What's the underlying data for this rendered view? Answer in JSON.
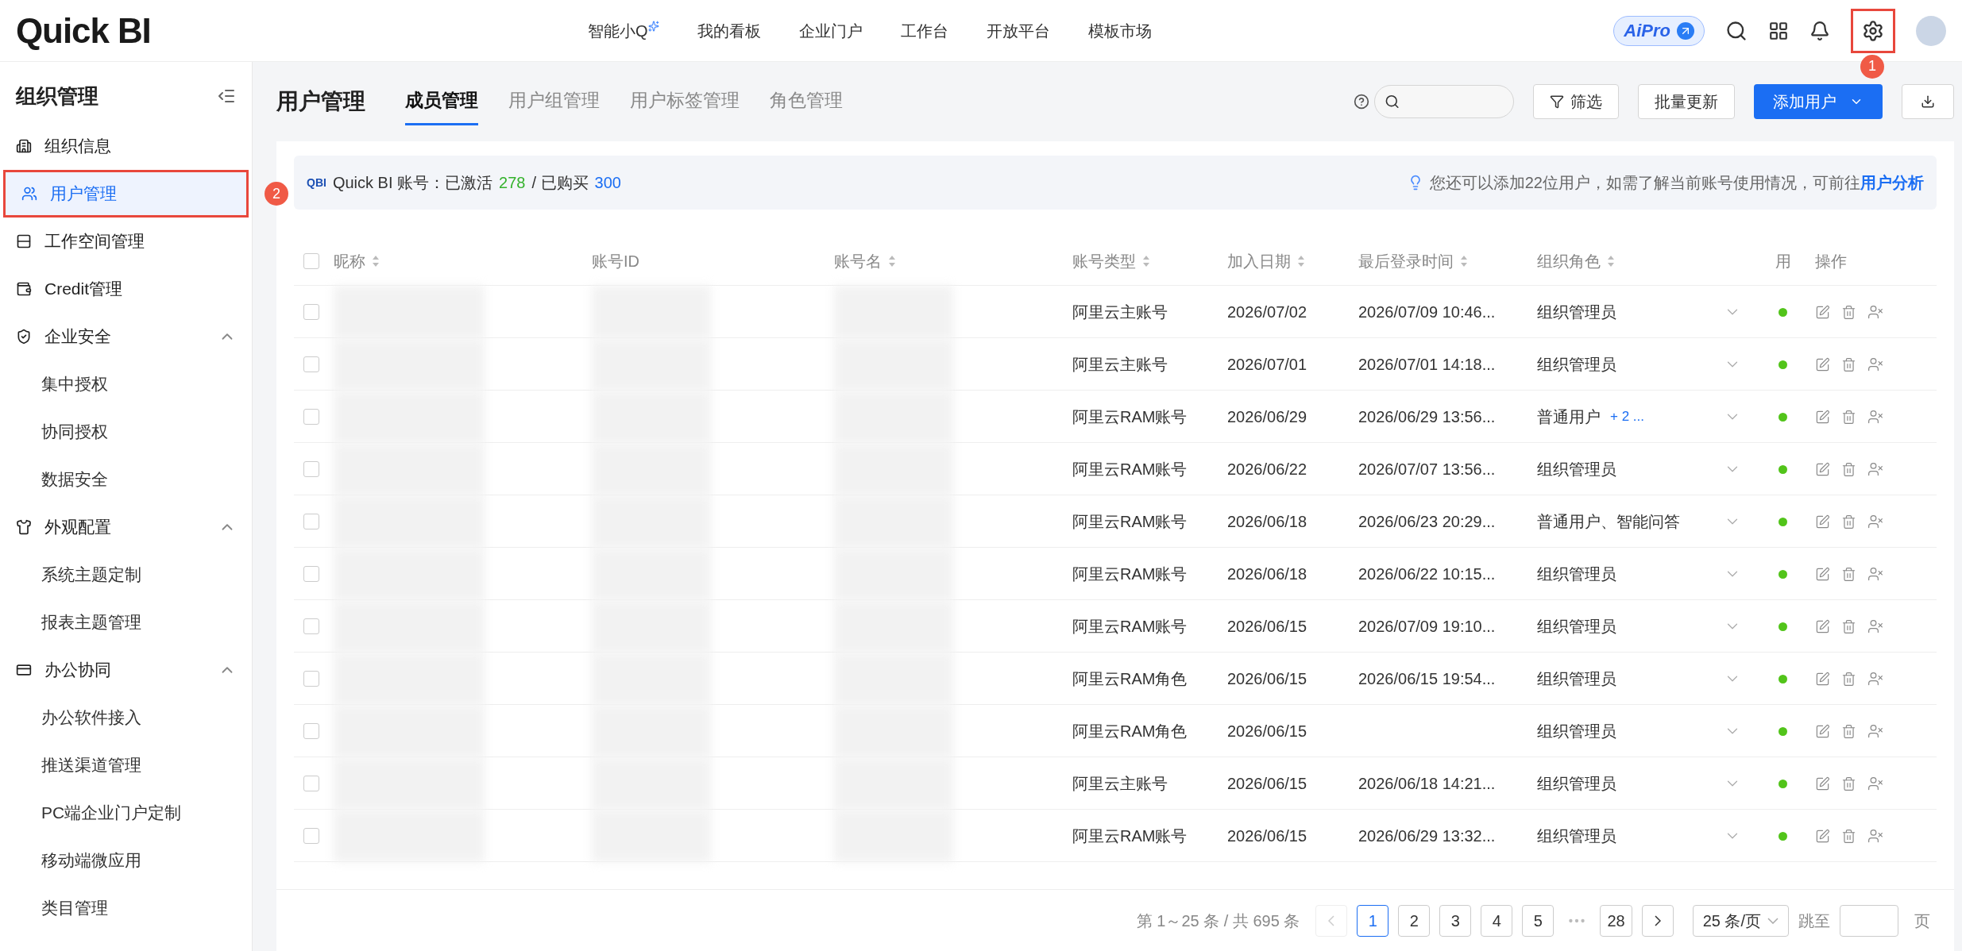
{
  "topbar": {
    "logo": "Quick BI",
    "nav": [
      {
        "label": "智能小Q",
        "kind": "ai",
        "selected": false
      },
      {
        "label": "我的看板",
        "kind": "link",
        "selected": false
      },
      {
        "label": "企业门户",
        "kind": "link",
        "selected": false
      },
      {
        "label": "工作台",
        "kind": "link",
        "selected": false
      },
      {
        "label": "开放平台",
        "kind": "link",
        "selected": false
      },
      {
        "label": "模板市场",
        "kind": "link",
        "selected": false
      }
    ],
    "ai_badge": "AiPro",
    "settings_highlight": {
      "highlighted": true,
      "badge": "1"
    }
  },
  "sidebar": {
    "title": "组织管理",
    "items": [
      {
        "label": "组织信息",
        "selected": false
      },
      {
        "label": "用户管理",
        "selected": true,
        "highlighted": true,
        "badge": "2"
      },
      {
        "label": "工作空间管理",
        "selected": false
      },
      {
        "label": "Credit管理",
        "selected": false
      },
      {
        "label": "企业安全",
        "selected": false,
        "expanded": true,
        "children": [
          {
            "label": "集中授权",
            "selected": false
          },
          {
            "label": "协同授权",
            "selected": false
          },
          {
            "label": "数据安全",
            "selected": false
          }
        ]
      },
      {
        "label": "外观配置",
        "selected": false,
        "expanded": true,
        "children": [
          {
            "label": "系统主题定制",
            "selected": false
          },
          {
            "label": "报表主题管理",
            "selected": false
          }
        ]
      },
      {
        "label": "办公协同",
        "selected": false,
        "expanded": true,
        "children": [
          {
            "label": "办公软件接入",
            "selected": false
          },
          {
            "label": "推送渠道管理",
            "selected": false
          },
          {
            "label": "PC端企业门户定制",
            "selected": false
          },
          {
            "label": "移动端微应用",
            "selected": false
          },
          {
            "label": "类目管理",
            "selected": false
          }
        ]
      }
    ]
  },
  "page": {
    "title": "用户管理",
    "tabs": [
      {
        "label": "成员管理",
        "selected": true
      },
      {
        "label": "用户组管理",
        "selected": false
      },
      {
        "label": "用户标签管理",
        "selected": false
      },
      {
        "label": "角色管理",
        "selected": false
      }
    ],
    "buttons": {
      "filter": "筛选",
      "bulk_update": "批量更新",
      "add_user": "添加用户"
    }
  },
  "info_bar": {
    "logo": "QBI",
    "account_label": "Quick BI 账号：已激活",
    "activated": "278",
    "separator": "/ 已购买",
    "purchased": "300",
    "hint": "您还可以添加22位用户，如需了解当前账号使用情况，可前往",
    "hint_link": "用户分析"
  },
  "table": {
    "columns": [
      {
        "label": "昵称",
        "sortable": true
      },
      {
        "label": "账号ID",
        "sortable": false
      },
      {
        "label": "账号名",
        "sortable": true
      },
      {
        "label": "账号类型",
        "sortable": true
      },
      {
        "label": "加入日期",
        "sortable": true
      },
      {
        "label": "最后登录时间",
        "sortable": true
      },
      {
        "label": "组织角色",
        "sortable": true
      },
      {
        "label": "用"
      },
      {
        "label": "操作"
      }
    ],
    "all_checked": false,
    "rows": [
      {
        "checked": false,
        "type": "阿里云主账号",
        "joined": "2026/07/02",
        "last_login": "2026/07/09 10:46...",
        "role": "组织管理员",
        "active": true
      },
      {
        "checked": false,
        "type": "阿里云主账号",
        "joined": "2026/07/01",
        "last_login": "2026/07/01 14:18...",
        "role": "组织管理员",
        "active": true
      },
      {
        "checked": false,
        "type": "阿里云RAM账号",
        "joined": "2026/06/29",
        "last_login": "2026/06/29 13:56...",
        "role": "普通用户",
        "role_extra": "+ 2 ...",
        "active": true
      },
      {
        "checked": false,
        "type": "阿里云RAM账号",
        "joined": "2026/06/22",
        "last_login": "2026/07/07 13:56...",
        "role": "组织管理员",
        "active": true
      },
      {
        "checked": false,
        "type": "阿里云RAM账号",
        "joined": "2026/06/18",
        "last_login": "2026/06/23 20:29...",
        "role": "普通用户、智能问答",
        "active": true
      },
      {
        "checked": false,
        "type": "阿里云RAM账号",
        "joined": "2026/06/18",
        "last_login": "2026/06/22 10:15...",
        "role": "组织管理员",
        "active": true
      },
      {
        "checked": false,
        "type": "阿里云RAM账号",
        "joined": "2026/06/15",
        "last_login": "2026/07/09 19:10...",
        "role": "组织管理员",
        "active": true
      },
      {
        "checked": false,
        "type": "阿里云RAM角色",
        "joined": "2026/06/15",
        "last_login": "2026/06/15 19:54...",
        "role": "组织管理员",
        "active": true
      },
      {
        "checked": false,
        "type": "阿里云RAM角色",
        "joined": "2026/06/15",
        "role": "组织管理员",
        "active": true
      },
      {
        "checked": false,
        "type": "阿里云主账号",
        "joined": "2026/06/15",
        "last_login": "2026/06/18 14:21...",
        "role": "组织管理员",
        "active": true
      },
      {
        "checked": false,
        "type": "阿里云RAM账号",
        "joined": "2026/06/15",
        "last_login": "2026/06/29 13:32...",
        "role": "组织管理员",
        "active": true
      }
    ]
  },
  "pagination": {
    "summary": "第 1～25 条 / 共 695 条",
    "prev_disabled": true,
    "pages": [
      {
        "label": "1",
        "kind": "page",
        "selected": true
      },
      {
        "label": "2",
        "kind": "page",
        "selected": false
      },
      {
        "label": "3",
        "kind": "page",
        "selected": false
      },
      {
        "label": "4",
        "kind": "page",
        "selected": false
      },
      {
        "label": "5",
        "kind": "page",
        "selected": false
      },
      {
        "kind": "ellipsis"
      },
      {
        "label": "28",
        "kind": "page",
        "selected": false
      }
    ],
    "page_size": "25 条/页",
    "jump_label": "跳至",
    "jump_suffix": "页"
  }
}
